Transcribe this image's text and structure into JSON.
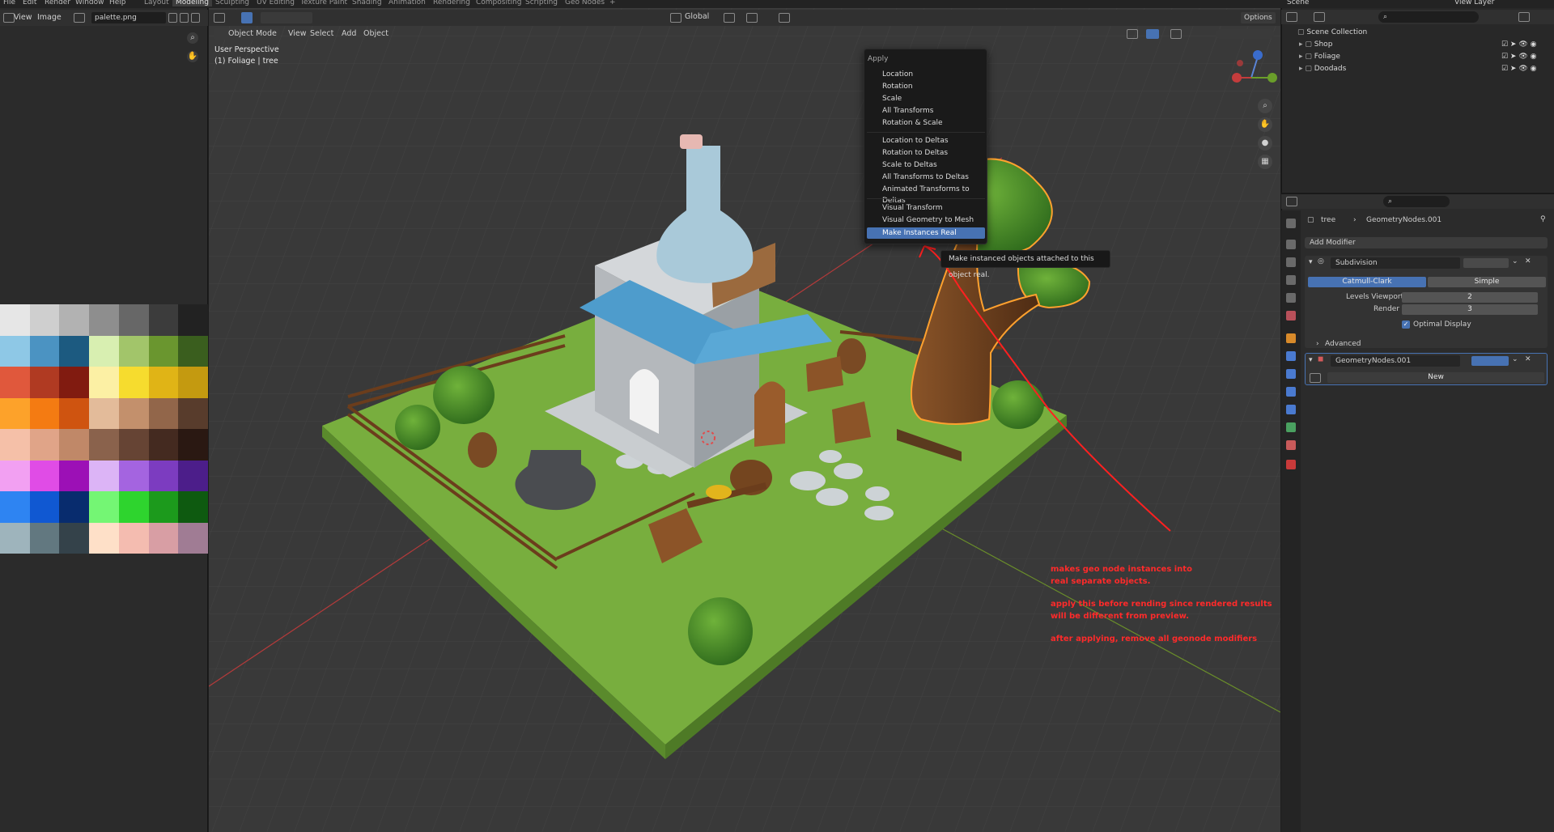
{
  "menubar": {
    "items": [
      "File",
      "Edit",
      "Render",
      "Window",
      "Help"
    ]
  },
  "workspaces": {
    "tabs": [
      "Layout",
      "Modeling",
      "Sculpting",
      "UV Editing",
      "Texture Paint",
      "Shading",
      "Animation",
      "Rendering",
      "Compositing",
      "Scripting",
      "Geo Nodes"
    ],
    "active": "Modeling",
    "add": "+"
  },
  "image_editor": {
    "view": "View",
    "image": "Image",
    "filename": "palette.png",
    "palette": [
      [
        "#e6e6e6",
        "#cfcfcf",
        "#b2b2b2",
        "#8e8e8e",
        "#676767",
        "#3c3c3c",
        "#222222"
      ],
      [
        "#8ec8e6",
        "#4b93c2",
        "#1c5a80",
        "#d8efb1",
        "#a2c56a",
        "#6a962f",
        "#3a5e1e"
      ],
      [
        "#e0583c",
        "#b03a22",
        "#811b10",
        "#fcf0a4",
        "#f6dc2e",
        "#e0b416",
        "#c49a10"
      ],
      [
        "#fda22a",
        "#f47b12",
        "#cf5410",
        "#e3bb9a",
        "#c3906c",
        "#92664a",
        "#583c2c"
      ],
      [
        "#f5c0a8",
        "#e0a488",
        "#c08868",
        "#8a624c",
        "#664434",
        "#442a20",
        "#2a1812"
      ],
      [
        "#f2a0f2",
        "#e04ce6",
        "#9c10b6",
        "#dcb4f6",
        "#a464e0",
        "#7c3cc0",
        "#4c1e8a"
      ],
      [
        "#2e84f2",
        "#1058d2",
        "#082c6e",
        "#74f674",
        "#2ed42e",
        "#1c9a1c",
        "#0e5a10"
      ],
      [
        "#9eb4bc",
        "#627880",
        "#34424a",
        "#fee0c8",
        "#f4bcb0",
        "#d89ea4",
        "#a07c94"
      ]
    ]
  },
  "viewport": {
    "mode": "Object Mode",
    "menu": [
      "View",
      "Select",
      "Add",
      "Object"
    ],
    "transform": "Global",
    "options": "Options",
    "perspective": "User Perspective",
    "active_object": "(1) Foliage | tree"
  },
  "apply_menu": {
    "title": "Apply",
    "group1": [
      "Location",
      "Rotation",
      "Scale",
      "All Transforms",
      "Rotation & Scale"
    ],
    "group2": [
      "Location to Deltas",
      "Rotation to Deltas",
      "Scale to Deltas",
      "All Transforms to Deltas",
      "Animated Transforms to Deltas"
    ],
    "group3": [
      "Visual Transform",
      "Visual Geometry to Mesh",
      "Make Instances Real"
    ],
    "selected": "Make Instances Real"
  },
  "tooltip": "Make instanced objects attached to this object real.",
  "annotation": {
    "color": "#ff2a2a",
    "lines": [
      "makes geo node instances into",
      "real separate objects.",
      "",
      "apply this before rending since rendered results",
      "will be different from preview.",
      "",
      "after applying, remove all geonode modifiers"
    ]
  },
  "outliner": {
    "scene": "Scene",
    "view_layer": "View Layer",
    "root": "Scene Collection",
    "collections": [
      "Shop",
      "Foliage",
      "Doodads"
    ]
  },
  "properties": {
    "object": "tree",
    "modifier_ref": "GeometryNodes.001",
    "add_modifier": "Add Modifier",
    "subdivision": {
      "name": "Subdivision",
      "tabs": [
        "Catmull-Clark",
        "Simple"
      ],
      "levels_viewport_label": "Levels Viewport",
      "levels_viewport": "2",
      "render_label": "Render",
      "render": "3",
      "optimal_display": "Optimal Display",
      "advanced": "Advanced"
    },
    "geonodes": {
      "name": "GeometryNodes.001",
      "new": "New"
    }
  },
  "colors": {
    "accent": "#4772b3",
    "viewport_bg": "#3a3a3a",
    "selection_outline": "#ffa12e"
  }
}
